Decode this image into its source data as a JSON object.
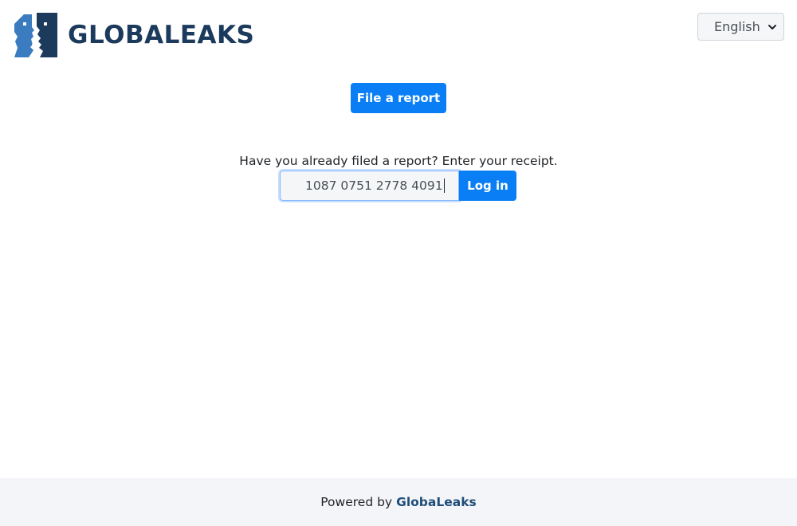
{
  "header": {
    "logo_text": "GLOBALEAKS",
    "logo_icon": "globaleaks-faces-logo",
    "language": {
      "selected": "English",
      "icon": "chevron-down-icon"
    }
  },
  "main": {
    "file_report_label": "File a report",
    "receipt_prompt": "Have you already filed a report? Enter your receipt.",
    "receipt_value": "1087 0751 2778 4091",
    "login_label": "Log in"
  },
  "footer": {
    "powered_by": "Powered by",
    "brand_link": "GlobaLeaks"
  },
  "colors": {
    "accent": "#0a7ff5",
    "logo_dark": "#1b3a5c",
    "logo_light": "#3b7bbf",
    "footer_bg": "#f4f5f8",
    "footer_brand": "#1f4e79"
  }
}
